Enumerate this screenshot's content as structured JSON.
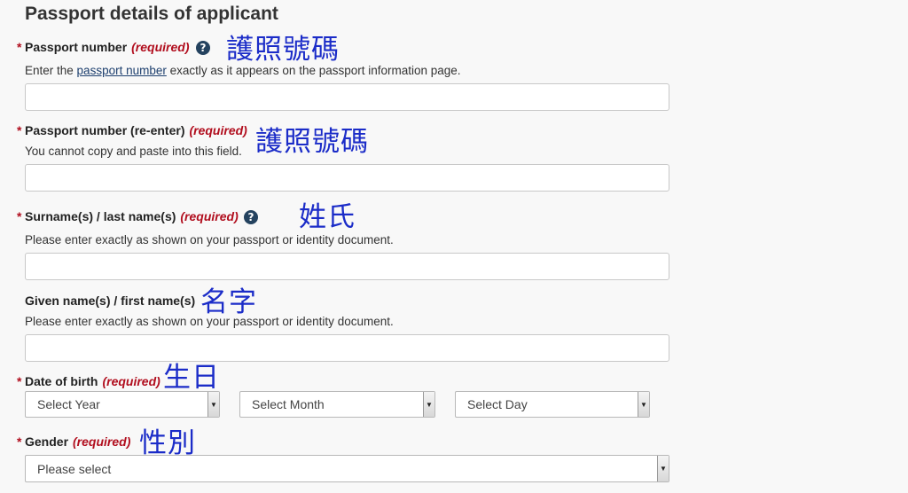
{
  "heading": "Passport details of applicant",
  "required_marker": "*",
  "required_text": "(required)",
  "help_glyph": "?",
  "passport_number": {
    "label": "Passport number",
    "hint_before": "Enter the ",
    "hint_link": "passport number",
    "hint_after": " exactly as it appears on the passport information page.",
    "annotation": "護照號碼"
  },
  "passport_reenter": {
    "label": "Passport number (re-enter)",
    "hint": "You cannot copy and paste into this field.",
    "annotation": "護照號碼"
  },
  "surname": {
    "label": "Surname(s) / last name(s)",
    "hint": "Please enter exactly as shown on your passport or identity document.",
    "annotation": "姓氏"
  },
  "given_name": {
    "label": "Given name(s) / first name(s)",
    "hint": "Please enter exactly as shown on your passport or identity document.",
    "annotation": "名字"
  },
  "dob": {
    "label": "Date of birth",
    "annotation": "生日",
    "year_value": "Select Year",
    "month_value": "Select Month",
    "day_value": "Select Day"
  },
  "gender": {
    "label": "Gender",
    "annotation": "性別",
    "value": "Please select"
  },
  "colors": {
    "required": "#b10e1e",
    "annotation": "#1b2cc8",
    "help_icon": "#24425f"
  },
  "icons": {
    "help": "question-circle-icon",
    "dropdown": "triangle-down-icon"
  }
}
